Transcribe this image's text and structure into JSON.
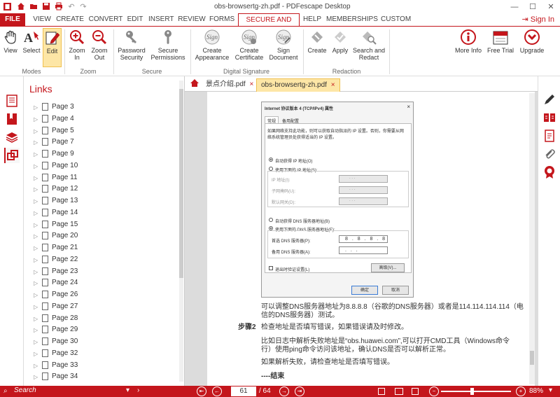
{
  "window": {
    "title": "obs-browsertg-zh.pdf - PDFescape Desktop",
    "title_doc": "obs-browsertg-zh.pdf",
    "title_sep": "-",
    "title_app": "PDFescape Desktop"
  },
  "menu": {
    "file": "FILE",
    "items": [
      "VIEW",
      "CREATE",
      "CONVERT",
      "EDIT",
      "INSERT",
      "REVIEW",
      "FORMS",
      "SECURE AND SIGN",
      "HELP",
      "MEMBERSHIPS",
      "CUSTOM"
    ],
    "active": "SECURE AND SIGN",
    "signin": "Sign In"
  },
  "ribbon": {
    "buttons": {
      "view": "View",
      "select": "Select",
      "edit": "Edit",
      "zoom_in_1": "Zoom",
      "zoom_in_2": "In",
      "zoom_out_1": "Zoom",
      "zoom_out_2": "Out",
      "pw_1": "Password",
      "pw_2": "Security",
      "sp_1": "Secure",
      "sp_2": "Permissions",
      "ca_1": "Create",
      "ca_2": "Appearance",
      "cc_1": "Create",
      "cc_2": "Certificate",
      "sd_1": "Sign",
      "sd_2": "Document",
      "rc": "Create",
      "ra": "Apply",
      "sr_1": "Search and",
      "sr_2": "Redact",
      "mi": "More Info",
      "ft": "Free Trial",
      "up": "Upgrade"
    },
    "groups": {
      "modes": "Modes",
      "zoom": "Zoom",
      "secure": "Secure",
      "digital": "Digital Signature",
      "redaction": "Redaction"
    }
  },
  "panel": {
    "title": "Links",
    "items": [
      "Page 3",
      "Page 4",
      "Page 5",
      "Page 7",
      "Page 9",
      "Page 10",
      "Page 11",
      "Page 12",
      "Page 13",
      "Page 14",
      "Page 15",
      "Page 20",
      "Page 21",
      "Page 22",
      "Page 23",
      "Page 24",
      "Page 26",
      "Page 27",
      "Page 28",
      "Page 29",
      "Page 30",
      "Page 32",
      "Page 33",
      "Page 34"
    ]
  },
  "tabs": [
    {
      "label": "景点介绍.pdf",
      "close": "×"
    },
    {
      "label": "obs-browsertg-zh.pdf",
      "close": "×"
    }
  ],
  "dialog": {
    "title": "Internet 协议版本 4 (TCP/IPv4) 属性",
    "close": "×",
    "tab_general": "常规",
    "tab_alt": "备用配置",
    "desc1": "如果网络支持此功能，则可以获取自动指派的 IP 设置。否则，你需要从网",
    "desc2": "络系统管理员处获得适当的 IP 设置。",
    "auto_ip": "自动获得 IP 地址(O)",
    "use_ip": "使用下面的 IP 地址(S):",
    "ip_addr": "IP 地址(I):",
    "subnet": "子网掩码(U):",
    "gateway": "默认网关(D):",
    "empty_ip": ".   .   .",
    "auto_dns": "自动获得 DNS 服务器地址(B)",
    "use_dns": "使用下面的 DNS 服务器地址(E):",
    "pref_dns": "首选 DNS 服务器(P):",
    "pref_dns_value": "8 . 8 . 8 . 8",
    "alt_dns": "备用 DNS 服务器(A):",
    "validate": "退出时验证设置(L)",
    "advanced": "高级(V)...",
    "ok": "确定",
    "cancel": "取消"
  },
  "doc": {
    "p1a": "可以调整DNS服务器地址为8.8.8.8（谷歌的DNS服务器）或者是114.114.114.114（电",
    "p1b": "信的DNS服务器）测试。",
    "step_label": "步骤2",
    "step_text": "检查地址是否填写错误，如果错误请及时修改。",
    "p2a": "比如日志中解析失败地址是“obs.huawei.com”,可以打开CMD工具（Windows命令",
    "p2b": "行）使用ping命令访问该地址，确认DNS是否可以解析正常。",
    "p3": "如果解析失败，请检查地址是否填写错误。",
    "end": "----结束"
  },
  "status": {
    "search": "Search",
    "page_current": "61",
    "page_total": "/ 64",
    "zoom": "88%"
  },
  "colors": {
    "accent": "#c4161c",
    "highlight": "#fde6a6"
  }
}
